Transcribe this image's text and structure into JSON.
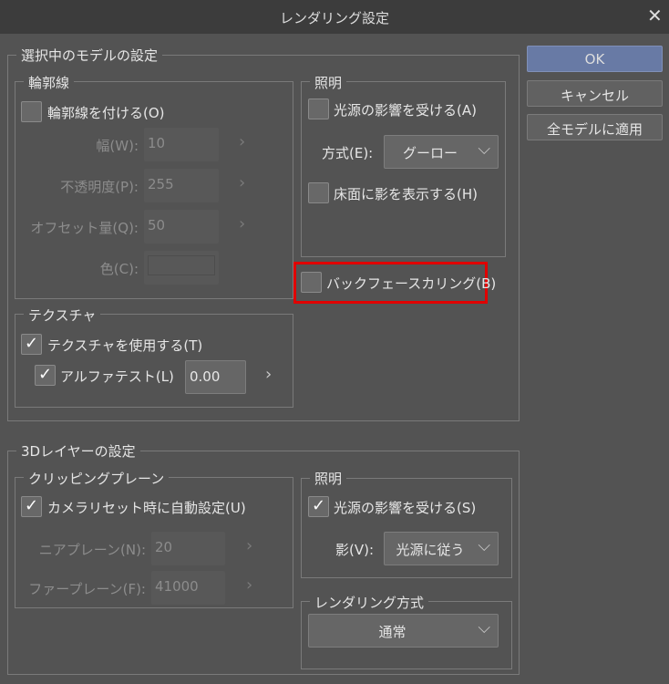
{
  "window": {
    "title": "レンダリング設定",
    "close": "✕"
  },
  "buttons": {
    "ok": "OK",
    "cancel": "キャンセル",
    "apply_all": "全モデルに適用"
  },
  "model": {
    "title": "選択中のモデルの設定",
    "outline": {
      "title": "輪郭線",
      "enable": "輪郭線を付ける(O)",
      "enable_checked": false,
      "width_label": "幅(W):",
      "width": "10",
      "opacity_label": "不透明度(P):",
      "opacity": "255",
      "offset_label": "オフセット量(Q):",
      "offset": "50",
      "color_label": "色(C):"
    },
    "lighting": {
      "title": "照明",
      "affect": "光源の影響を受ける(A)",
      "affect_checked": false,
      "method_label": "方式(E):",
      "method": "グーロー",
      "floor_shadow": "床面に影を表示する(H)",
      "floor_shadow_checked": false
    },
    "backface": {
      "label": "バックフェースカリング(B)",
      "checked": false
    },
    "texture": {
      "title": "テクスチャ",
      "use": "テクスチャを使用する(T)",
      "use_checked": true,
      "alpha": "アルファテスト(L)",
      "alpha_checked": true,
      "alpha_value": "0.00"
    }
  },
  "layer": {
    "title": "3Dレイヤーの設定",
    "clipping": {
      "title": "クリッピングプレーン",
      "auto": "カメラリセット時に自動設定(U)",
      "auto_checked": true,
      "near_label": "ニアプレーン(N):",
      "near": "20",
      "far_label": "ファープレーン(F):",
      "far": "41000"
    },
    "lighting": {
      "title": "照明",
      "affect": "光源の影響を受ける(S)",
      "affect_checked": true,
      "shadow_label": "影(V):",
      "shadow": "光源に従う"
    },
    "render": {
      "title": "レンダリング方式",
      "method": "通常"
    }
  },
  "icons": {
    "check": "✓",
    "chevron_right": "›",
    "chevron_down": "⌵"
  }
}
